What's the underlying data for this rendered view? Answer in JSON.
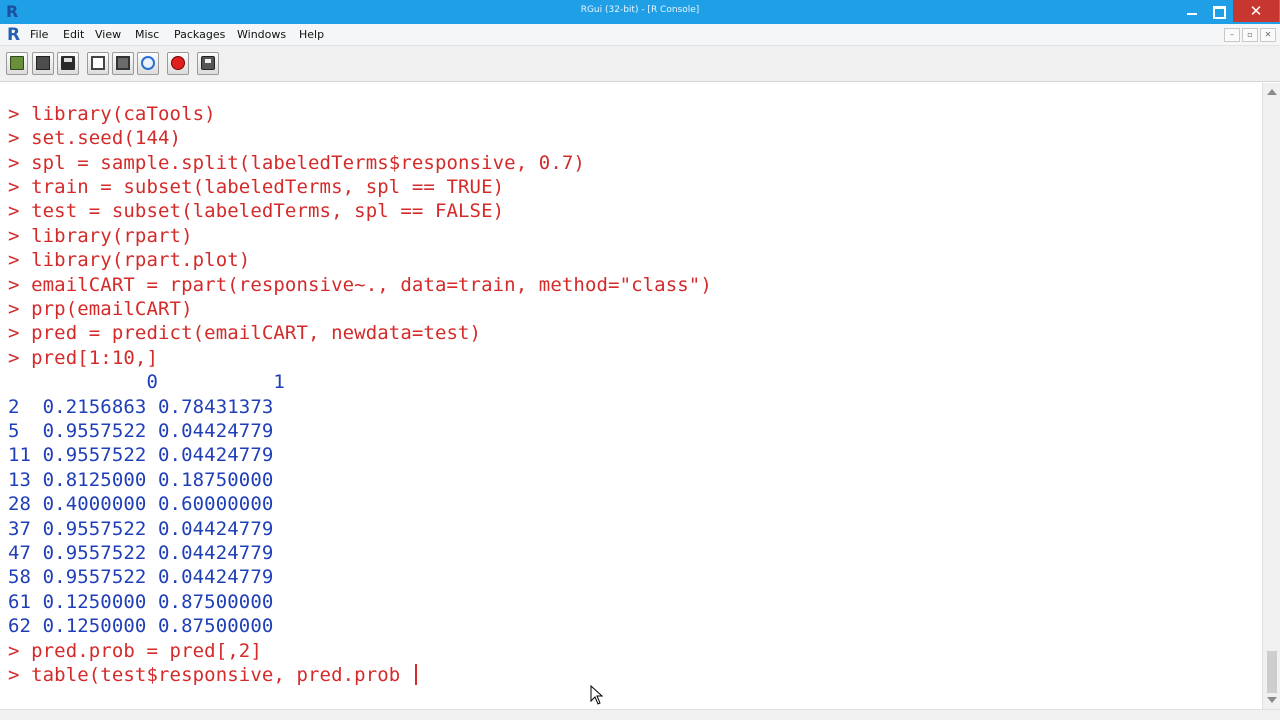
{
  "window": {
    "title": "RGui (32-bit) - [R Console]",
    "app_icon": "R",
    "close_glyph": "✕"
  },
  "menubar": {
    "icon": "R",
    "items": [
      "File",
      "Edit",
      "View",
      "Misc",
      "Packages",
      "Windows",
      "Help"
    ],
    "mdi_buttons": [
      "–",
      "▫",
      "✕"
    ]
  },
  "toolbar": {
    "buttons": [
      "open-script-icon",
      "load-workspace-icon",
      "save-icon",
      "copy-icon",
      "paste-icon",
      "refresh-icon",
      "stop-icon",
      "print-icon"
    ]
  },
  "console": {
    "commands_top": [
      "> library(caTools)",
      "> set.seed(144)",
      "> spl = sample.split(labeledTerms$responsive, 0.7)",
      "> train = subset(labeledTerms, spl == TRUE)",
      "> test = subset(labeledTerms, spl == FALSE)",
      "> library(rpart)",
      "> library(rpart.plot)",
      "> emailCART = rpart(responsive~., data=train, method=\"class\")",
      "> prp(emailCART)",
      "> pred = predict(emailCART, newdata=test)",
      "> pred[1:10,]"
    ],
    "output": [
      "            0          1",
      "2  0.2156863 0.78431373",
      "5  0.9557522 0.04424779",
      "11 0.9557522 0.04424779",
      "13 0.8125000 0.18750000",
      "28 0.4000000 0.60000000",
      "37 0.9557522 0.04424779",
      "47 0.9557522 0.04424779",
      "58 0.9557522 0.04424779",
      "61 0.1250000 0.87500000",
      "62 0.1250000 0.87500000"
    ],
    "commands_bottom": [
      "> pred.prob = pred[,2]",
      "> table(test$responsive, pred.prob "
    ]
  },
  "colors": {
    "titlebar": "#1fa0e6",
    "command": "#d42a2a",
    "output": "#1f3fb8",
    "close_button": "#c7372f"
  }
}
